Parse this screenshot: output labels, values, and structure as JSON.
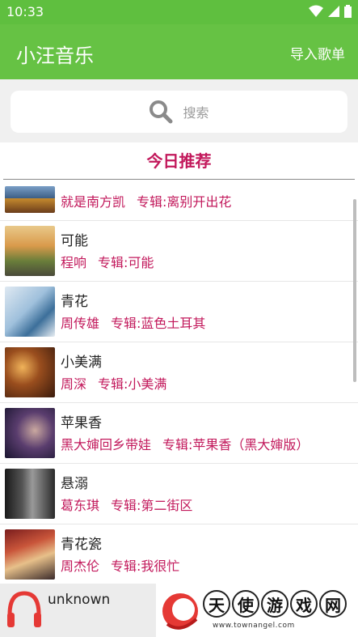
{
  "status": {
    "time": "10:33"
  },
  "appbar": {
    "title": "小汪音乐",
    "action": "导入歌单"
  },
  "search": {
    "placeholder": "搜索"
  },
  "section": {
    "title": "今日推荐"
  },
  "songs": [
    {
      "title": "",
      "artist": "就是南方凯",
      "album": "专辑:离别开出花"
    },
    {
      "title": "可能",
      "artist": "程响",
      "album": "专辑:可能"
    },
    {
      "title": "青花",
      "artist": "周传雄",
      "album": "专辑:蓝色土耳其"
    },
    {
      "title": "小美满",
      "artist": "周深",
      "album": "专辑:小美满"
    },
    {
      "title": "苹果香",
      "artist": "黑大婶回乡带娃",
      "album": "专辑:苹果香（黑大婶版）"
    },
    {
      "title": "悬溺",
      "artist": "葛东琪",
      "album": "专辑:第二街区"
    },
    {
      "title": "青花瓷",
      "artist": "周杰伦",
      "album": "专辑:我很忙"
    }
  ],
  "player": {
    "track": "unknown"
  },
  "ad": {
    "chars": [
      "天",
      "使",
      "游",
      "戏",
      "网"
    ],
    "url": "www.townangel.com"
  },
  "colors": {
    "appbar": "#66c244",
    "accent": "#c2185b"
  }
}
